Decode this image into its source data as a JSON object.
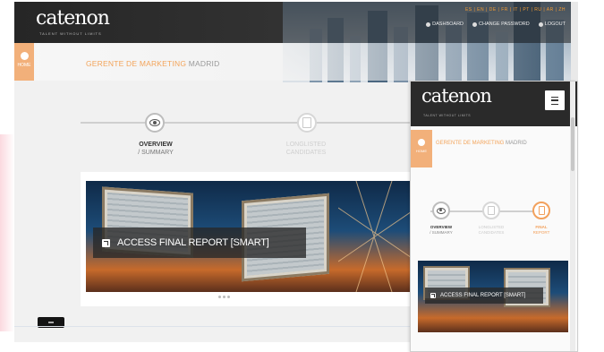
{
  "desktop": {
    "logo": "catenon",
    "logo_tagline": "TALENT WITHOUT LIMITS",
    "utility_links": "ES | EN | DE | FR | IT | PT | RU | AR | ZH",
    "menu": [
      {
        "label": "DASHBOARD",
        "icon": "dashboard-icon"
      },
      {
        "label": "CHANGE PASSWORD",
        "icon": "key-icon"
      },
      {
        "label": "LOGOUT",
        "icon": "logout-icon"
      }
    ],
    "home_tab_label": "HOME",
    "breadcrumb_title": "GERENTE DE MARKETING",
    "breadcrumb_location": "MADRID",
    "steps": [
      {
        "title": "OVERVIEW",
        "subtitle": "/ SUMMARY",
        "icon": "eye-icon"
      },
      {
        "title": "LONGLISTED",
        "subtitle": "CANDIDATES",
        "icon": "document-icon"
      }
    ],
    "cta_label": "ACCESS FINAL REPORT [SMART]",
    "cta_icon": "external-link-icon"
  },
  "mobile": {
    "logo": "catenon",
    "logo_tagline": "TALENT WITHOUT LIMITS",
    "menu_icon": "hamburger-icon",
    "home_tab_label": "HOME",
    "breadcrumb_title": "GERENTE DE MARKETING",
    "breadcrumb_location": "MADRID",
    "steps": [
      {
        "title": "OVERVIEW",
        "subtitle": "/ SUMMARY",
        "icon": "eye-icon"
      },
      {
        "title": "LONGLISTED",
        "subtitle": "CANDIDATES",
        "icon": "document-icon"
      },
      {
        "title": "FINAL",
        "subtitle": "REPORT",
        "icon": "mobile-icon"
      }
    ],
    "cta_label": "ACCESS FINAL REPORT [SMART]"
  },
  "colors": {
    "accent_orange": "#f3a45a",
    "header_dark": "#2a2a2a",
    "hero_blue": "#1d4c78"
  }
}
